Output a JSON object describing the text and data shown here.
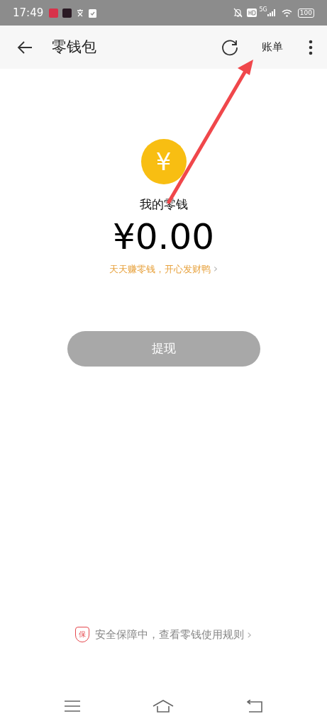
{
  "status_bar": {
    "time": "17:49",
    "network": "5G",
    "battery": "100"
  },
  "header": {
    "title": "零钱包",
    "bill_link": "账单"
  },
  "balance": {
    "currency_symbol": "¥",
    "label": "我的零钱",
    "amount": "¥0.00",
    "promo": "天天赚零钱，开心发财鸭",
    "promo_arrow": "›"
  },
  "withdraw_button": {
    "label": "提现",
    "disabled": true
  },
  "footer": {
    "badge": "保",
    "text": "安全保障中，查看零钱使用规则",
    "arrow": "›"
  }
}
